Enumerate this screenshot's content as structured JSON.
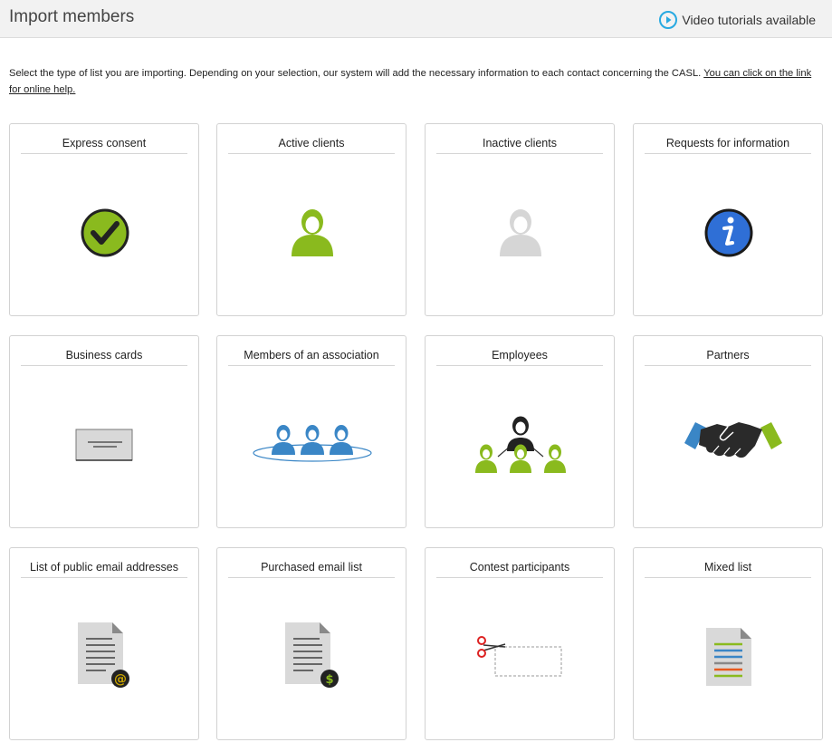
{
  "header": {
    "title": "Import members",
    "video_label": "Video tutorials available"
  },
  "intro": {
    "text": "Select the type of list you are importing. Depending on your selection, our system will add the necessary information to each contact concerning the CASL. ",
    "link": "You can click on the link for online help."
  },
  "cards": [
    {
      "title": "Express consent",
      "icon": "checkmark-circle-icon"
    },
    {
      "title": "Active clients",
      "icon": "person-green-icon"
    },
    {
      "title": "Inactive clients",
      "icon": "person-gray-icon"
    },
    {
      "title": "Requests for information",
      "icon": "info-circle-icon"
    },
    {
      "title": "Business cards",
      "icon": "business-card-icon"
    },
    {
      "title": "Members of an association",
      "icon": "association-table-icon"
    },
    {
      "title": "Employees",
      "icon": "org-chart-icon"
    },
    {
      "title": "Partners",
      "icon": "handshake-icon"
    },
    {
      "title": "List of public email addresses",
      "icon": "document-email-icon"
    },
    {
      "title": "Purchased email list",
      "icon": "document-dollar-icon"
    },
    {
      "title": "Contest participants",
      "icon": "scissors-coupon-icon"
    },
    {
      "title": "Mixed list",
      "icon": "document-colored-lines-icon"
    }
  ],
  "colors": {
    "green": "#8aba1e",
    "blue": "#3a86c6",
    "info_blue": "#2f6fd6",
    "gray_person": "#d6d6d6",
    "video_blue": "#27a9e1"
  }
}
